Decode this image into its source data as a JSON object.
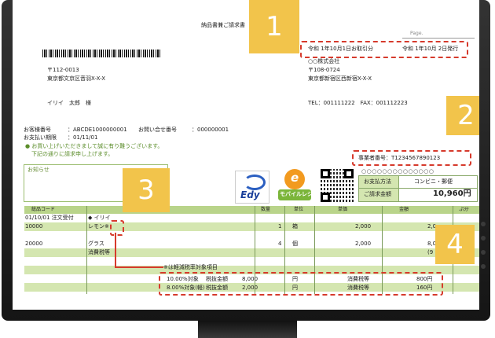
{
  "invoice": {
    "title": "納品書兼ご請求書",
    "page_label": "Page.",
    "dates": {
      "transaction": "令和 1年10月1日お取引分",
      "issued": "令和 1年10月 2日発行"
    },
    "recipient": {
      "postal": "〒112-0013",
      "address": "東京都文京区音羽X-X-X",
      "name": "イリイ　太郎　様"
    },
    "sender": {
      "company": "○○株式会社",
      "postal": "〒108-0724",
      "address": "東京都新宿区西新宿X-X-X",
      "tel": "TEL：001111222　FAX：001112223"
    },
    "customer": {
      "number_label": "お客様番号",
      "number_value": "：ABCDE1000000001",
      "inquiry_label": "お問い合せ番号",
      "inquiry_value": "：000000001",
      "due_label": "お支払い期限",
      "due_value": "：01/11/01"
    },
    "thanks_line1": "お買い上げいただきまして誠に有り難うございます。",
    "thanks_line2": "下記の通りに請求申し上げます。",
    "notice_label": "お知らせ",
    "registration": "事業者番号：T1234567890123",
    "circles": "○○○○○○○○○○○○○○",
    "payment": {
      "method_label": "お支払方法",
      "method_value": "コンビニ・郵便",
      "amount_label": "ご請求金額",
      "amount_value": "10,960円"
    },
    "logos": {
      "edy": "Edy",
      "mobile": "モバイルレジ",
      "e_mark": "e"
    },
    "table": {
      "headers": [
        "総品コード",
        "数量",
        "単位",
        "単価",
        "金額",
        "ぷ分"
      ],
      "group_label": "01/10/01 注文受付",
      "group_name": "◆ イリイ",
      "rows": [
        {
          "code": "10000",
          "name": "レモン※",
          "qty": "1",
          "unit": "箱",
          "price": "2,000",
          "amount": "2,0"
        },
        {
          "code": "20000",
          "name": "グラス",
          "qty": "4",
          "unit": "個",
          "price": "2,000",
          "amount": "8,0"
        },
        {
          "code": "",
          "name": "消費税等",
          "qty": "",
          "unit": "",
          "price": "",
          "amount": "(9"
        }
      ],
      "reduced_note": "※は軽減税率対象項目",
      "tax_rows": [
        {
          "target": "10.00%対象",
          "label": "税抜金額",
          "amount": "8,000",
          "unit": "円",
          "tax_label": "消費税等",
          "tax": "800円"
        },
        {
          "target": "8.00%対象(軽)",
          "label": "税抜金額",
          "amount": "2,000",
          "unit": "円",
          "tax_label": "消費税等",
          "tax": "160円"
        }
      ]
    }
  },
  "callouts": [
    "1",
    "2",
    "3",
    "4"
  ],
  "colors": {
    "callout": "#f2c44b",
    "highlight": "#d63a2c",
    "table_green": "#d4e6b0",
    "header_green": "#b9d48a"
  }
}
